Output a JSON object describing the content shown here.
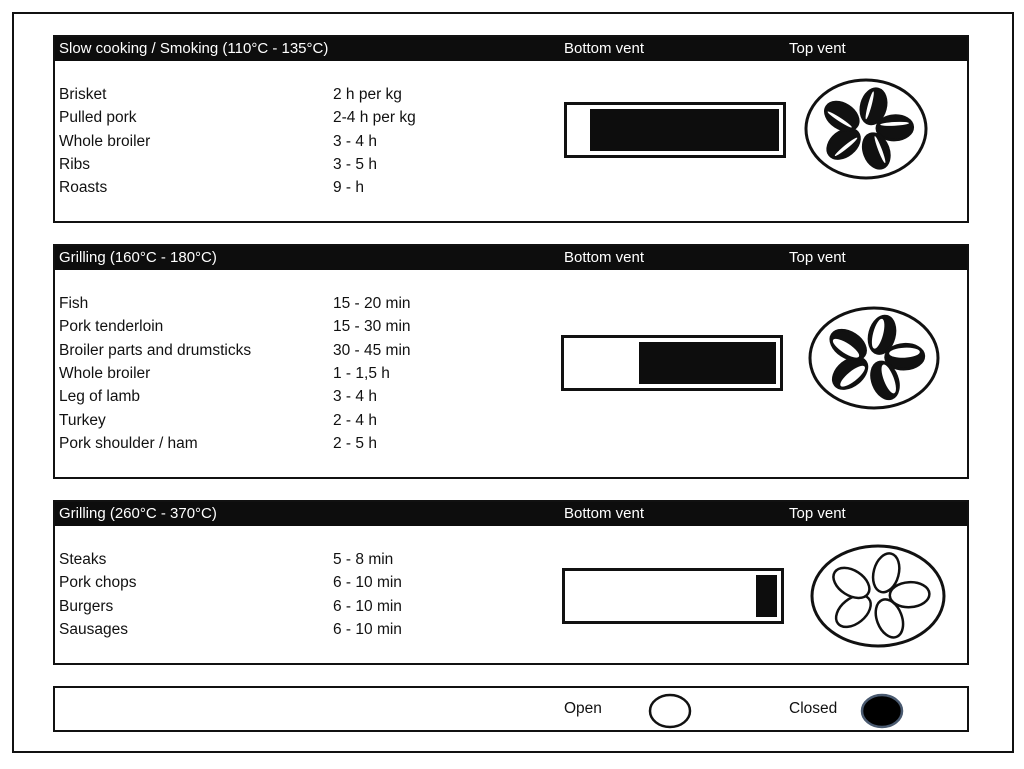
{
  "header_labels": {
    "bottom_vent": "Bottom vent",
    "top_vent": "Top vent"
  },
  "sections": [
    {
      "title": "Slow cooking / Smoking (110°C - 135°C)",
      "items": [
        {
          "food": "Brisket",
          "time": "2 h per kg"
        },
        {
          "food": "Pulled pork",
          "time": "2-4 h per kg"
        },
        {
          "food": "Whole broiler",
          "time": "3 - 4 h"
        },
        {
          "food": "Ribs",
          "time": "3 - 5 h"
        },
        {
          "food": "Roasts",
          "time": "9 - h"
        }
      ],
      "bottom_vent_closed_fraction": 0.9,
      "top_vent_open_fraction": 0.15
    },
    {
      "title": "Grilling (160°C - 180°C)",
      "items": [
        {
          "food": "Fish",
          "time": "15 - 20 min"
        },
        {
          "food": "Pork tenderloin",
          "time": "15 - 30 min"
        },
        {
          "food": "Broiler parts and drumsticks",
          "time": "30 - 45 min"
        },
        {
          "food": "Whole broiler",
          "time": "1 - 1,5 h"
        },
        {
          "food": "Leg of lamb",
          "time": "3 - 4 h"
        },
        {
          "food": "Turkey",
          "time": "2 - 4 h"
        },
        {
          "food": "Pork shoulder / ham",
          "time": "2 - 5 h"
        }
      ],
      "bottom_vent_closed_fraction": 0.65,
      "top_vent_open_fraction": 0.4
    },
    {
      "title": "Grilling (260°C - 370°C)",
      "items": [
        {
          "food": "Steaks",
          "time": "5 - 8 min"
        },
        {
          "food": "Pork chops",
          "time": "6 - 10 min"
        },
        {
          "food": "Burgers",
          "time": "6 - 10 min"
        },
        {
          "food": "Sausages",
          "time": "6 - 10 min"
        }
      ],
      "bottom_vent_closed_fraction": 0.1,
      "top_vent_open_fraction": 1.0
    }
  ],
  "legend": {
    "open_label": "Open",
    "closed_label": "Closed",
    "closed_color": "#000000",
    "closed_outline": "#4a5a70"
  }
}
